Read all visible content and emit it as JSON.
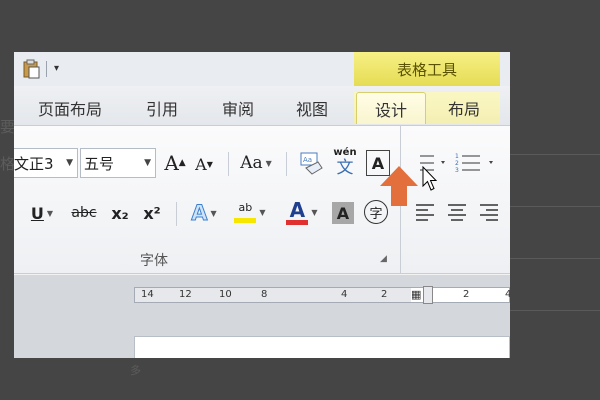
{
  "quick_access": {
    "dropdown_glyph": "▾"
  },
  "contextual": {
    "title": "表格工具"
  },
  "tabs": [
    {
      "label": "页面布局"
    },
    {
      "label": "引用"
    },
    {
      "label": "审阅"
    },
    {
      "label": "视图"
    },
    {
      "label": "设计"
    },
    {
      "label": "布局"
    }
  ],
  "font": {
    "name_value": "文正3",
    "size_value": "五号",
    "grow_label": "A",
    "shrink_label": "A",
    "case_label": "Aa",
    "phonetic_top": "wén",
    "phonetic_bottom": "文",
    "bold_a": "A",
    "underline_label": "U",
    "strike_label": "abc",
    "sub_label": "x₂",
    "sup_label": "x²",
    "effect_label": "A",
    "highlight_label": "ab",
    "color_label": "A",
    "shade_label": "A",
    "enclose_label": "字",
    "group_label": "字体"
  },
  "ruler": {
    "numbers": [
      "14",
      "12",
      "10",
      "8",
      "4",
      "2",
      "2",
      "4"
    ]
  },
  "background_chars": [
    "要",
    "格",
    "多"
  ],
  "colors": {
    "ctx_yellow": "#e5dc54",
    "arrow_orange": "#e36f3d",
    "font_red": "#e03030",
    "highlight_yellow": "#f7e600"
  }
}
